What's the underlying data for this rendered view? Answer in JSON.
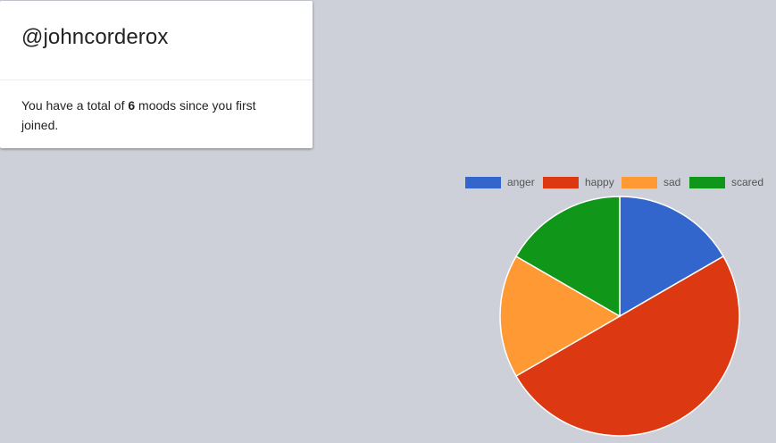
{
  "profile": {
    "username": "@johncorderox",
    "summary_prefix": "You have a total of ",
    "mood_count": "6",
    "summary_suffix": " moods since you first joined."
  },
  "colors": {
    "anger": "#3366cc",
    "happy": "#dc3912",
    "sad": "#ff9933",
    "scared": "#109618"
  },
  "chart_data": {
    "type": "pie",
    "title": "",
    "legend_position": "top-right",
    "categories": [
      "anger",
      "happy",
      "sad",
      "scared"
    ],
    "values": [
      1,
      3,
      1,
      1
    ],
    "colors": [
      "#3366cc",
      "#dc3912",
      "#ff9933",
      "#109618"
    ]
  }
}
